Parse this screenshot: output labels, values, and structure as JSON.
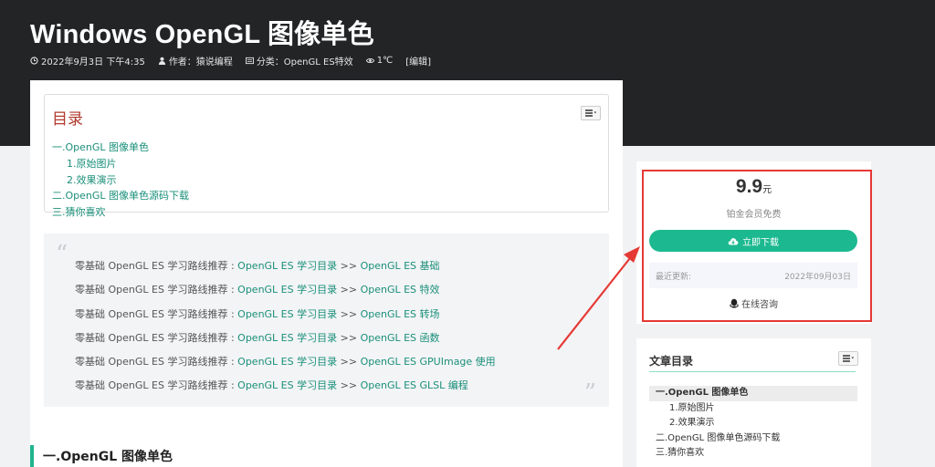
{
  "header": {
    "title": "Windows OpenGL 图像单色",
    "meta": {
      "date": "2022年9月3日 下午4:35",
      "author": "作者：猿说编程",
      "category": "分类：OpenGL ES特效",
      "views": "1℃",
      "edit": "[编辑]"
    }
  },
  "toc": {
    "title": "目录",
    "items": [
      {
        "label": "一.OpenGL 图像单色",
        "sub": false
      },
      {
        "label": "1.原始图片",
        "sub": true
      },
      {
        "label": "2.效果演示",
        "sub": true
      },
      {
        "label": "二.OpenGL 图像单色源码下载",
        "sub": false
      },
      {
        "label": "三.猜你喜欢",
        "sub": false
      }
    ]
  },
  "quote": {
    "lines": [
      {
        "prefix": "零基础 OpenGL ES 学习路线推荐 : ",
        "link1": "OpenGL ES 学习目录",
        "sep": " >> ",
        "link2": "OpenGL ES 基础"
      },
      {
        "prefix": "零基础 OpenGL ES 学习路线推荐 : ",
        "link1": "OpenGL ES 学习目录",
        "sep": "  >> ",
        "link2": "OpenGL ES 特效"
      },
      {
        "prefix": "零基础 OpenGL ES 学习路线推荐 : ",
        "link1": "OpenGL ES 学习目录",
        "sep": "  >> ",
        "link2": "OpenGL ES 转场"
      },
      {
        "prefix": "零基础 OpenGL ES 学习路线推荐 :  ",
        "link1": "OpenGL ES 学习目录",
        "sep": " >> ",
        "link2": "OpenGL ES 函数"
      },
      {
        "prefix": "零基础 OpenGL ES 学习路线推荐 :  ",
        "link1": "OpenGL ES 学习目录",
        "sep": " >> ",
        "link2": "OpenGL ES GPUImage 使用"
      },
      {
        "prefix": "零基础 OpenGL ES 学习路线推荐 :  ",
        "link1": "OpenGL ES 学习目录",
        "sep": " >> ",
        "link2": "OpenGL ES GLSL 编程"
      }
    ]
  },
  "section_heading": "一.OpenGL 图像单色",
  "download": {
    "price": "9.9",
    "unit": "元",
    "member_note": "铂金会员免费",
    "button_label": "立即下载",
    "updated_label": "最近更新:",
    "updated_date": "2022年09月03日",
    "consult_label": "在线咨询"
  },
  "side_toc": {
    "title": "文章目录",
    "items": [
      {
        "label": "一.OpenGL 图像单色",
        "active": true,
        "sub": false
      },
      {
        "label": "1.原始图片",
        "active": false,
        "sub": true
      },
      {
        "label": "2.效果演示",
        "active": false,
        "sub": true
      },
      {
        "label": "二.OpenGL 图像单色源码下载",
        "active": false,
        "sub": false
      },
      {
        "label": "三.猜你喜欢",
        "active": false,
        "sub": false
      }
    ]
  },
  "colors": {
    "accent": "#1cb990",
    "link": "#1a8f7a",
    "annotation": "#e53935",
    "hero_bg": "#222426"
  }
}
